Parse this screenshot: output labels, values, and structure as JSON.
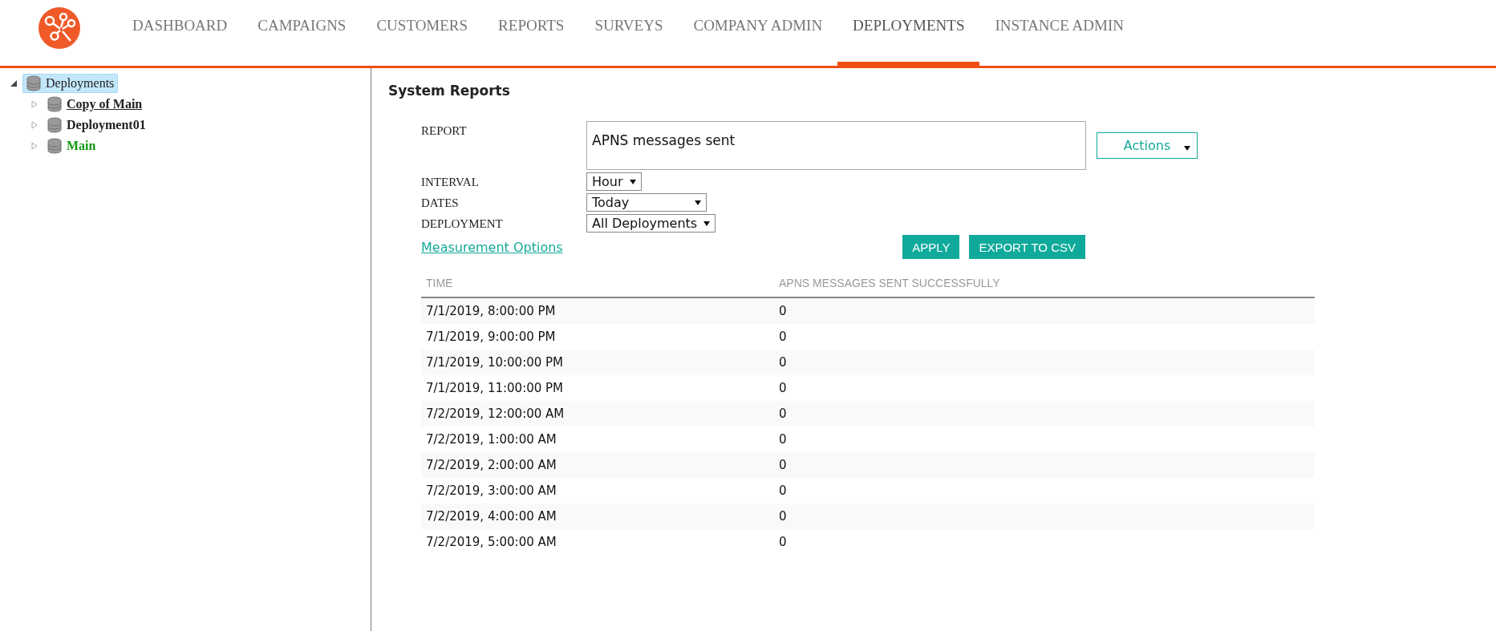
{
  "nav": [
    {
      "label": "DASHBOARD",
      "selected": false
    },
    {
      "label": "CAMPAIGNS",
      "selected": false
    },
    {
      "label": "CUSTOMERS",
      "selected": false
    },
    {
      "label": "REPORTS",
      "selected": false
    },
    {
      "label": "SURVEYS",
      "selected": false
    },
    {
      "label": "COMPANY ADMIN",
      "selected": false
    },
    {
      "label": "DEPLOYMENTS",
      "selected": true
    },
    {
      "label": "INSTANCE ADMIN",
      "selected": false
    }
  ],
  "tree": {
    "label": "Deployments",
    "expanded": true,
    "selected": true,
    "children": [
      {
        "label": "Copy of Main",
        "expanded": false,
        "hovered": true,
        "color": "#222222"
      },
      {
        "label": "Deployment01",
        "expanded": false,
        "hovered": false,
        "color": "#222222"
      },
      {
        "label": "Main",
        "expanded": false,
        "hovered": false,
        "color": "#119911"
      }
    ]
  },
  "page_title": "System Reports",
  "form": [
    {
      "label": "REPORT",
      "kind": "textbox",
      "value": "APNS messages sent"
    },
    {
      "label": "INTERVAL",
      "kind": "dropdown",
      "value": "Hour"
    },
    {
      "label": "DATES",
      "kind": "dropdown",
      "value": "Today"
    },
    {
      "label": "DEPLOYMENT",
      "kind": "dropdown",
      "value": "All Deployments"
    }
  ],
  "actions_button": "Actions",
  "measurement_link": "Measurement Options",
  "buttons": [
    "APPLY",
    "EXPORT TO CSV"
  ],
  "table": {
    "columns": [
      "TIME",
      "APNS MESSAGES SENT SUCCESSFULLY"
    ],
    "rows": [
      [
        "7/1/2019, 8:00:00 PM",
        "0"
      ],
      [
        "7/1/2019, 9:00:00 PM",
        "0"
      ],
      [
        "7/1/2019, 10:00:00 PM",
        "0"
      ],
      [
        "7/1/2019, 11:00:00 PM",
        "0"
      ],
      [
        "7/2/2019, 12:00:00 AM",
        "0"
      ],
      [
        "7/2/2019, 1:00:00 AM",
        "0"
      ],
      [
        "7/2/2019, 2:00:00 AM",
        "0"
      ],
      [
        "7/2/2019, 3:00:00 AM",
        "0"
      ],
      [
        "7/2/2019, 4:00:00 AM",
        "0"
      ],
      [
        "7/2/2019, 5:00:00 AM",
        "0"
      ]
    ]
  }
}
